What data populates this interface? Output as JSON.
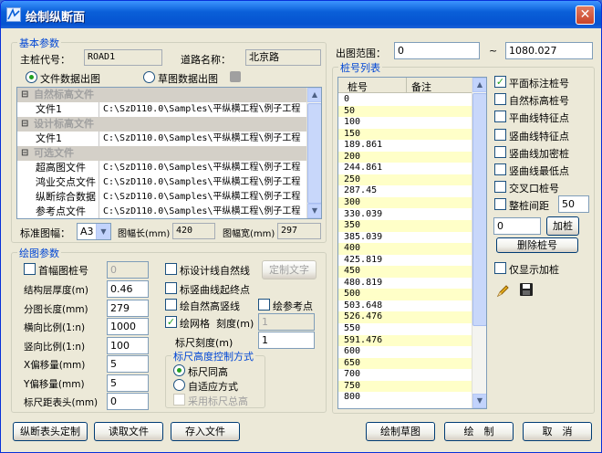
{
  "window": {
    "title": "绘制纵断面",
    "close": "✕"
  },
  "basic": {
    "group_title": "基本参数",
    "main_pile_label": "主桩代号：",
    "main_pile_value": "ROAD1",
    "road_name_label": "道路名称：",
    "road_name_value": "北京路",
    "radio_file": "文件数据出图",
    "radio_sketch": "草图数据出图",
    "tree": [
      {
        "type": "hdr",
        "mark": "⊟",
        "name": "自然标高文件"
      },
      {
        "type": "row",
        "name": "文件1",
        "value": "C:\\SzD110.0\\Samples\\平纵横工程\\例子工程"
      },
      {
        "type": "hdr",
        "mark": "⊟",
        "name": "设计标高文件"
      },
      {
        "type": "row",
        "name": "文件1",
        "value": "C:\\SzD110.0\\Samples\\平纵横工程\\例子工程"
      },
      {
        "type": "hdr",
        "mark": "⊟",
        "name": "可选文件"
      },
      {
        "type": "row",
        "name": "超高图文件",
        "value": "C:\\SzD110.0\\Samples\\平纵横工程\\例子工程"
      },
      {
        "type": "row",
        "name": "鸿业交点文件",
        "value": "C:\\SzD110.0\\Samples\\平纵横工程\\例子工程"
      },
      {
        "type": "row",
        "name": "纵断综合数据",
        "value": "C:\\SzD110.0\\Samples\\平纵横工程\\例子工程"
      },
      {
        "type": "row",
        "name": "参考点文件",
        "value": "C:\\SzD110.0\\Samples\\平纵横工程\\例子工程"
      }
    ],
    "paper_label": "标准图幅：",
    "paper_value": "A3",
    "paper_len_label": "图幅长(mm)",
    "paper_len_value": "420",
    "paper_wid_label": "图幅宽(mm)",
    "paper_wid_value": "297"
  },
  "draw": {
    "group_title": "绘图参数",
    "first_pile_label": "首幅图桩号",
    "first_pile_value": "0",
    "fields": [
      {
        "label": "结构层厚度(m)",
        "value": "0.46"
      },
      {
        "label": "分图长度(mm)",
        "value": "279"
      },
      {
        "label": "横向比例(1:n)",
        "value": "1000"
      },
      {
        "label": "竖向比例(1:n)",
        "value": "100"
      },
      {
        "label": "X偏移量(mm)",
        "value": "5"
      },
      {
        "label": "Y偏移量(mm)",
        "value": "5"
      },
      {
        "label": "标尺距表头(mm)",
        "value": "0"
      }
    ],
    "chk_design_line": "标设计线自然线",
    "btn_custom_text": "定制文字",
    "chk_vcurve": "标竖曲线起终点",
    "chk_natural_elev": "绘自然高竖线",
    "chk_ref_point": "绘参考点",
    "chk_grid": "绘网格",
    "grid_scale_label": "刻度(m)",
    "grid_scale_value": "1",
    "ruler_scale_label": "标尺刻度(m)",
    "ruler_scale_value": "1",
    "ruler_group_title": "标尺高度控制方式",
    "ruler_same": "标尺同高",
    "ruler_adaptive": "自适应方式",
    "ruler_total": "采用标尺总高"
  },
  "range": {
    "label": "出图范围：",
    "from": "0",
    "sep": "~",
    "to": "1080.027"
  },
  "pile_list": {
    "group_title": "桩号列表",
    "col_pile": "桩号",
    "col_note": "备注",
    "rows": [
      "0",
      "50",
      "100",
      "150",
      "189.861",
      "200",
      "244.861",
      "250",
      "287.45",
      "300",
      "330.039",
      "350",
      "385.039",
      "400",
      "425.819",
      "450",
      "480.819",
      "500",
      "503.648",
      "526.476",
      "550",
      "591.476",
      "600",
      "650",
      "700",
      "750",
      "800"
    ]
  },
  "options": [
    {
      "label": "平面标注桩号",
      "checked": true
    },
    {
      "label": "自然标高桩号",
      "checked": false
    },
    {
      "label": "平曲线特征点",
      "checked": false
    },
    {
      "label": "竖曲线特征点",
      "checked": false
    },
    {
      "label": "竖曲线加密桩",
      "checked": false
    },
    {
      "label": "竖曲线最低点",
      "checked": false
    },
    {
      "label": "交叉口桩号",
      "checked": false
    }
  ],
  "whole_pile": {
    "label": "整桩间距",
    "value": "50"
  },
  "add_pile": {
    "value": "0",
    "button": "加桩"
  },
  "delete_pile": "删除桩号",
  "only_show_added": "仅显示加桩",
  "buttons": {
    "header_custom": "纵断表头定制",
    "read_file": "读取文件",
    "save_file": "存入文件",
    "draw_sketch": "绘制草图",
    "draw": "绘　制",
    "cancel": "取　消"
  }
}
